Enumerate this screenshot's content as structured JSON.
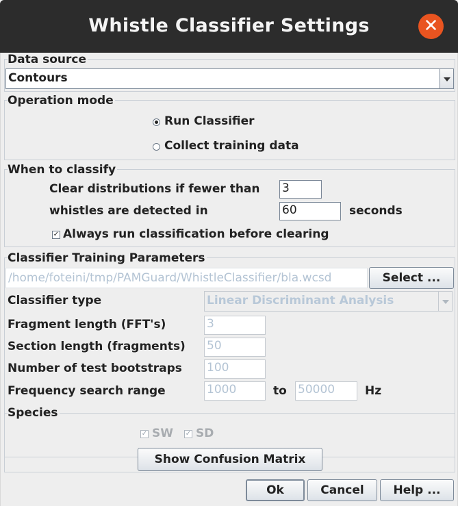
{
  "window": {
    "title": "Whistle Classifier Settings"
  },
  "data_source": {
    "legend": "Data source",
    "selected": "Contours"
  },
  "operation_mode": {
    "legend": "Operation mode",
    "options": [
      {
        "label": "Run Classifier",
        "selected": true
      },
      {
        "label": "Collect training data",
        "selected": false
      }
    ]
  },
  "when_to_classify": {
    "legend": "When to classify",
    "clear_label": "Clear distributions if fewer than",
    "clear_value": "3",
    "whistles_label": "whistles are detected in",
    "whistles_value": "60",
    "seconds_label": "seconds",
    "always_run_label": "Always run classification before clearing",
    "always_run_checked": true
  },
  "training": {
    "legend": "Classifier Training Parameters",
    "file_path": "/home/foteini/tmp/PAMGuard/WhistleClassifier/bla.wcsd",
    "select_button": "Select ...",
    "classifier_type_label": "Classifier type",
    "classifier_type_value": "Linear Discriminant Analysis",
    "fragment_length_label": "Fragment length (FFT's)",
    "fragment_length_value": "3",
    "section_length_label": "Section length (fragments)",
    "section_length_value": "50",
    "bootstraps_label": "Number of test bootstraps",
    "bootstraps_value": "100",
    "freq_range_label": "Frequency search range",
    "freq_min": "1000",
    "freq_to": "to",
    "freq_max": "50000",
    "freq_unit": "Hz"
  },
  "species": {
    "legend": "Species",
    "items": [
      {
        "label": "SW",
        "checked": true
      },
      {
        "label": "SD",
        "checked": true
      }
    ],
    "confusion_button": "Show Confusion Matrix"
  },
  "footer": {
    "ok": "Ok",
    "cancel": "Cancel",
    "help": "Help ..."
  },
  "icons": {
    "close": "close-icon",
    "dropdown": "chevron-down-icon",
    "check": "checkmark-icon"
  },
  "colors": {
    "titlebar": "#2c2c2c",
    "close_button": "#e95420",
    "disabled_text": "#b8c8d8"
  }
}
